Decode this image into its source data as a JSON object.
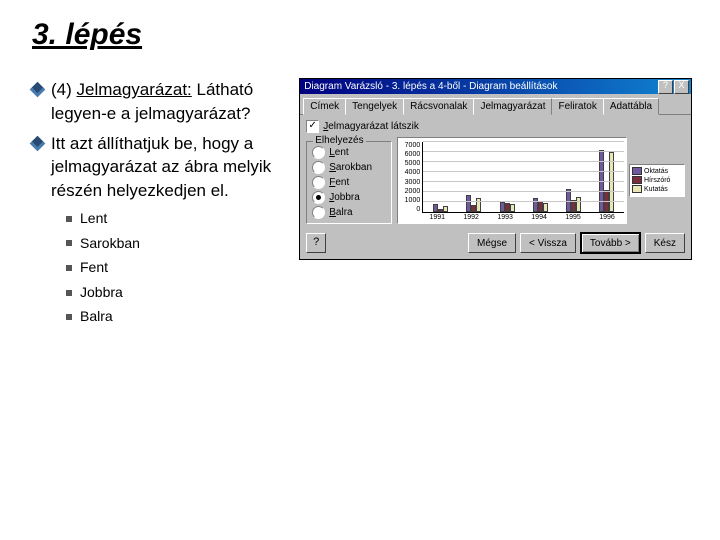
{
  "title": "3. lépés",
  "bullets": [
    {
      "prefix": "(4) ",
      "link": "Jelmagyarázat:",
      "rest": " Látható legyen-e a jelmagyarázat?"
    },
    {
      "text": "Itt azt állíthatjuk be, hogy a jelmagyarázat az ábra melyik részén helyezkedjen el."
    }
  ],
  "sublist": [
    "Lent",
    "Sarokban",
    "Fent",
    "Jobbra",
    "Balra"
  ],
  "dialog": {
    "title": "Diagram Varázsló - 3. lépés a 4-ből - Diagram beállítások",
    "help_char": "?",
    "close_char": "X",
    "tabs": [
      "Címek",
      "Tengelyek",
      "Rácsvonalak",
      "Jelmagyarázat",
      "Feliratok",
      "Adattábla"
    ],
    "active_tab": "Jelmagyarázat",
    "checkbox": {
      "checked": true,
      "label_u": "J",
      "label_rest": "elmagyarázat látszik"
    },
    "frame_title": "Elhelyezés",
    "radios": [
      {
        "u": "L",
        "rest": "ent",
        "sel": false
      },
      {
        "u": "S",
        "rest": "arokban",
        "sel": false
      },
      {
        "u": "F",
        "rest": "ent",
        "sel": false
      },
      {
        "u": "J",
        "rest": "obbra",
        "sel": true
      },
      {
        "u": "B",
        "rest": "alra",
        "sel": false
      }
    ],
    "buttons": {
      "help": "?",
      "cancel": "Mégse",
      "back": "< Vissza",
      "next": "Tovább >",
      "finish": "Kész"
    }
  },
  "chart_data": {
    "type": "bar",
    "ylim": [
      0,
      7000
    ],
    "yticks": [
      0,
      1000,
      2000,
      3000,
      4000,
      5000,
      6000,
      7000
    ],
    "categories": [
      "1991",
      "1992",
      "1993",
      "1994",
      "1995",
      "1996"
    ],
    "series": [
      {
        "name": "Oktatás",
        "color": "#6f5aa0",
        "values": [
          800,
          1700,
          1000,
          1400,
          2300,
          6200
        ]
      },
      {
        "name": "Hírszóró",
        "color": "#7a2d3b",
        "values": [
          350,
          700,
          900,
          1100,
          1200,
          2200
        ]
      },
      {
        "name": "Kutatás",
        "color": "#e9e6b6",
        "values": [
          600,
          1400,
          800,
          900,
          1500,
          6000
        ]
      }
    ]
  }
}
